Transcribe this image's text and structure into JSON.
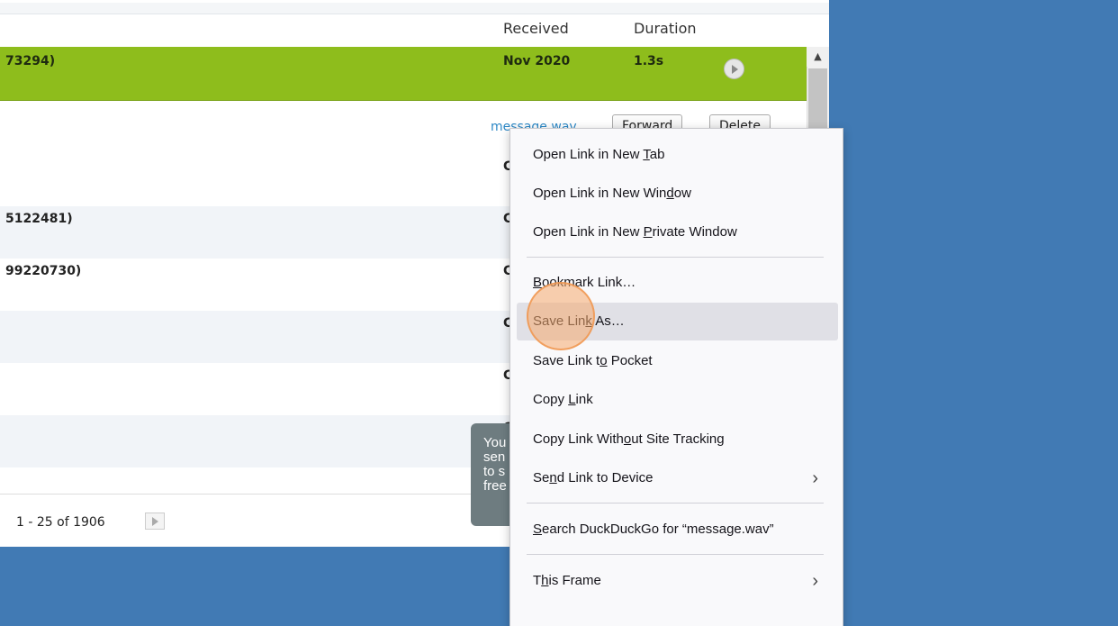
{
  "table": {
    "headers": {
      "received": "Received",
      "duration": "Duration"
    },
    "selected_row": {
      "caller": "73294)",
      "received": "Nov 2020",
      "duration": "1.3s"
    },
    "message_actions": {
      "link": "message.wav",
      "forward": "Forward",
      "delete": "Delete"
    },
    "rows": [
      {
        "caller": "",
        "received": "C"
      },
      {
        "caller": "5122481)",
        "received": "C"
      },
      {
        "caller": "99220730)",
        "received": "C"
      },
      {
        "caller": "",
        "received": "C"
      },
      {
        "caller": "",
        "received": "C"
      },
      {
        "caller": "",
        "received": "C"
      }
    ]
  },
  "pager": {
    "range": "1 - 25 of 1906"
  },
  "tooltip": {
    "lines": [
      "You",
      "sen",
      "to s",
      "free"
    ]
  },
  "context_menu": {
    "open_new_tab": {
      "pre": "Open Link in New ",
      "key": "T",
      "post": "ab"
    },
    "open_new_window": {
      "pre": "Open Link in New Win",
      "key": "d",
      "post": "ow"
    },
    "open_private": {
      "pre": "Open Link in New ",
      "key": "P",
      "post": "rivate Window"
    },
    "bookmark": {
      "pre": "",
      "key": "B",
      "post": "ookmark Link…"
    },
    "save_as": {
      "pre": "Save Lin",
      "key": "k",
      "post": " As…"
    },
    "save_pocket": {
      "pre": "Save Link t",
      "key": "o",
      "post": " Pocket"
    },
    "copy_link": {
      "pre": "Copy ",
      "key": "L",
      "post": "ink"
    },
    "copy_no_tracking": {
      "pre": "Copy Link With",
      "key": "o",
      "post": "ut Site Tracking"
    },
    "send_device": {
      "pre": "Se",
      "key": "n",
      "post": "d Link to Device"
    },
    "search": {
      "pre": "",
      "key": "S",
      "post": "earch DuckDuckGo for “message.wav”"
    },
    "this_frame": {
      "pre": "T",
      "key": "h",
      "post": "is Frame"
    }
  },
  "colors": {
    "selected_row": "#8ebd1c",
    "background": "#417ab4",
    "link": "#2d88c6"
  }
}
